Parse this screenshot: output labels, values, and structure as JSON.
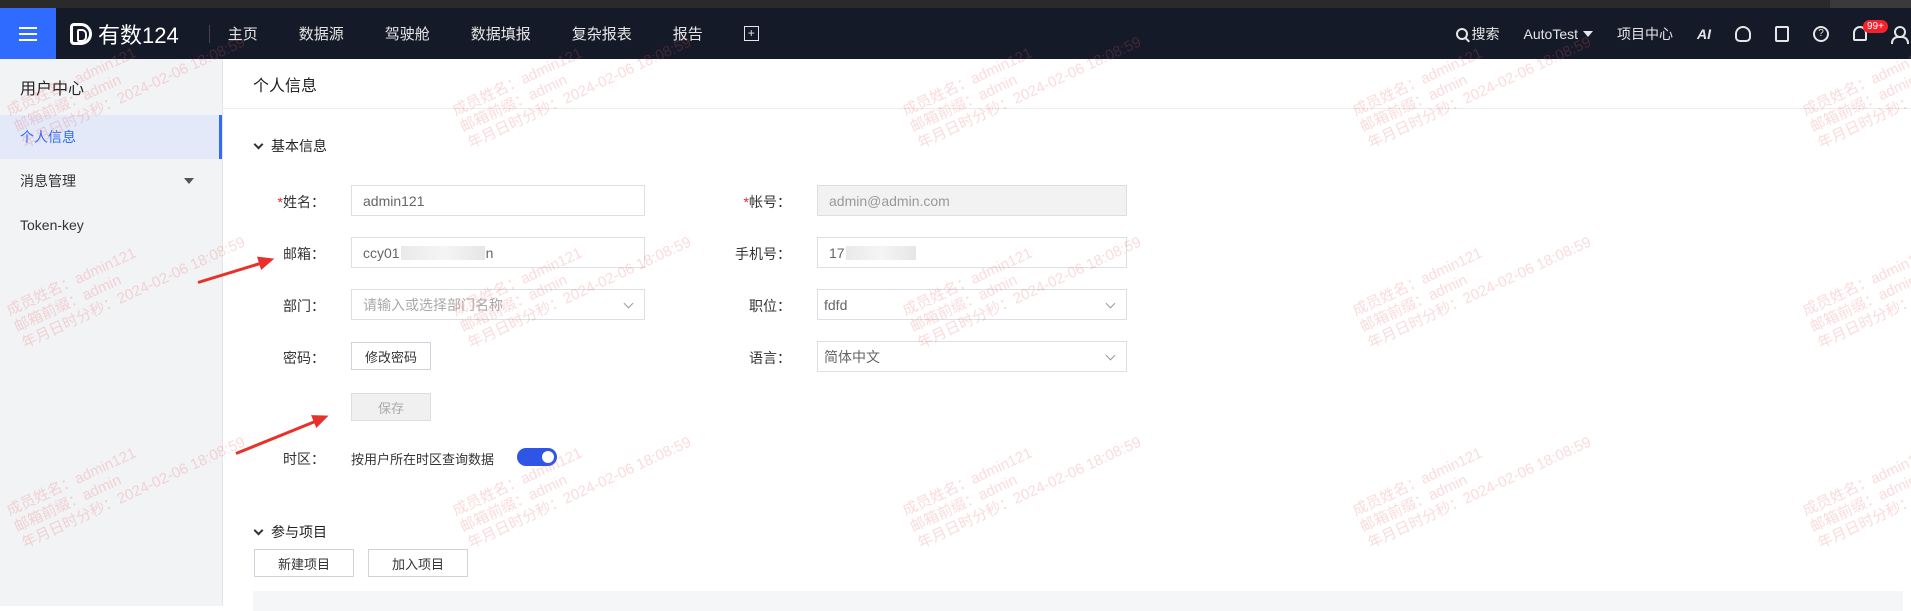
{
  "app": {
    "logo_text": "有数124"
  },
  "nav": {
    "items": [
      "主页",
      "数据源",
      "驾驶舱",
      "数据填报",
      "复杂报表",
      "报告"
    ],
    "search_label": "搜索",
    "workspace": "AutoTest",
    "project_center": "项目中心",
    "ai_label": "AI",
    "badge_count": "99+"
  },
  "sidebar": {
    "title": "用户中心",
    "items": [
      "个人信息",
      "消息管理",
      "Token-key"
    ]
  },
  "page": {
    "title": "个人信息",
    "basic_section": "基本信息",
    "projects_section": "参与项目"
  },
  "form": {
    "name_label": "姓名：",
    "name_value": "admin121",
    "account_label": "帐号：",
    "account_value": "admin@admin.com",
    "email_label": "邮箱：",
    "email_prefix": "ccy01",
    "email_suffix": "n",
    "phone_label": "手机号：",
    "phone_prefix": "17",
    "dept_label": "部门：",
    "dept_placeholder": "请输入或选择部门名称",
    "position_label": "职位：",
    "position_value": "fdfd",
    "password_label": "密码：",
    "change_password_button": "修改密码",
    "language_label": "语言：",
    "language_value": "简体中文",
    "save_button": "保存",
    "timezone_label": "时区：",
    "timezone_desc": "按用户所在时区查询数据",
    "timezone_enabled": true
  },
  "projects": {
    "new_button": "新建项目",
    "join_button": "加入项目"
  },
  "watermark": {
    "lines": "成员姓名：admin121\n邮箱前缀：admin\n年月日时分秒：2024-02-06 18:08:59"
  },
  "colors": {
    "brand": "#2f6bff",
    "nav_bg": "#141a28",
    "annotation_arrow": "#e8312a"
  }
}
